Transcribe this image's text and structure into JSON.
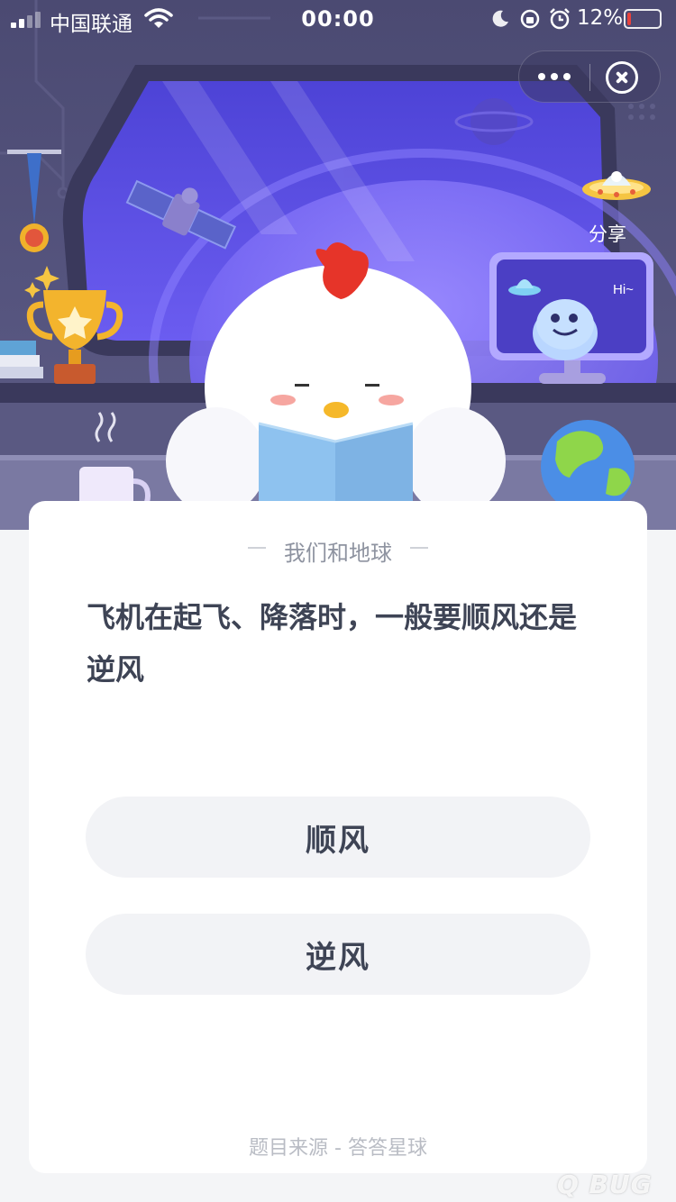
{
  "status_bar": {
    "carrier": "中国联通",
    "time": "00:00",
    "battery_percent_text": "12%",
    "battery_level": 0.12,
    "signal_bars": 2
  },
  "mini_program_menu": {
    "more_icon": "ellipsis-icon",
    "close_icon": "close-circle-icon"
  },
  "share": {
    "label": "分享",
    "icon": "ufo-icon"
  },
  "scene": {
    "monitor_text": "Hi~",
    "colors": {
      "window_glass": "#5b4fe0",
      "window_frame": "#3b3a5e",
      "chick_body": "#ffffff",
      "chick_comb": "#e63429",
      "book": "#8ec2ef",
      "earth_ocean": "#4b8ee6",
      "earth_land": "#8fd64a"
    }
  },
  "card": {
    "category": "我们和地球",
    "question": "飞机在起飞、降落时，一般要顺风还是逆风",
    "answers": [
      {
        "label": "顺风"
      },
      {
        "label": "逆风"
      }
    ],
    "source": "题目来源 - 答答星球"
  },
  "watermark": {
    "text": "Q BUG"
  }
}
